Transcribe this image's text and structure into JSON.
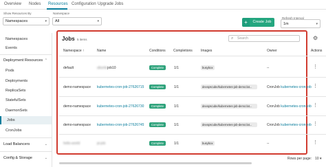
{
  "topnav": {
    "tabs": [
      "Overview",
      "Nodes",
      "Resources",
      "Configuration",
      "Upgrade Jobs"
    ],
    "active": "Resources"
  },
  "filters": {
    "show_resources_label": "Show Resources By",
    "show_resources_value": "Namespaces",
    "namespace_label": "Namespace",
    "namespace_value": "All",
    "refresh_label": "Refresh Interval",
    "refresh_value": "1m",
    "create_label": "Create Job",
    "plus_icon": "+"
  },
  "sidebar": {
    "items": [
      {
        "label": "Namespaces",
        "type": "item"
      },
      {
        "label": "Events",
        "type": "item"
      },
      {
        "label": "Deployment Resources",
        "type": "section"
      },
      {
        "label": "Pods",
        "type": "item"
      },
      {
        "label": "Deployments",
        "type": "item"
      },
      {
        "label": "ReplicaSets",
        "type": "item"
      },
      {
        "label": "StatefulSets",
        "type": "item"
      },
      {
        "label": "DaemonSets",
        "type": "item"
      },
      {
        "label": "Jobs",
        "type": "item",
        "active": true
      },
      {
        "label": "CronJobs",
        "type": "item"
      },
      {
        "label": "Load Balancers",
        "type": "section"
      },
      {
        "label": "Config & Storage",
        "type": "section"
      }
    ]
  },
  "jobs": {
    "title": "Jobs",
    "count": "5 items",
    "search_placeholder": "Search",
    "columns": [
      "Namespace",
      "Name",
      "Conditions",
      "Completions",
      "Images",
      "Owner",
      "Actions"
    ],
    "rows": [
      {
        "namespace": "default",
        "name": "job10",
        "name_prefix_blurred": "ubuntu",
        "condition": "Complete",
        "completions": "1/1",
        "image": "busybox",
        "owner": "--",
        "owner_kind": ""
      },
      {
        "namespace": "demo-namespace",
        "name": "kubernetes-cron-job-27626715",
        "condition": "Complete",
        "completions": "1/1",
        "image": "devopscube/kubernetes-job-demo:lat...",
        "owner_kind": "CronJob",
        "owner": "kubernetes-cron-job"
      },
      {
        "namespace": "demo-namespace",
        "name": "kubernetes-cron-job-27626730",
        "condition": "Complete",
        "completions": "1/1",
        "image": "devopscube/kubernetes-job-demo:lat...",
        "owner_kind": "CronJob",
        "owner": "kubernetes-cron-job"
      },
      {
        "namespace": "demo-namespace",
        "name": "kubernetes-cron-job-27626745",
        "condition": "Complete",
        "completions": "1/1",
        "image": "devopscube/kubernetes-job-demo:lat...",
        "owner_kind": "CronJob",
        "owner": "kubernetes-cron-job"
      },
      {
        "namespace": "hello-world",
        "namespace_blurred": true,
        "name": "pi-job",
        "name_blurred": true,
        "condition": "Complete",
        "completions": "1/1",
        "image": "busybox",
        "owner": "--",
        "owner_kind": ""
      }
    ],
    "sort_icon": "arrow-up-icon",
    "rows_per_page_label": "Rows per page:",
    "rows_per_page_value": "10"
  },
  "colors": {
    "accent": "#0a7d9c",
    "create_button": "#24a67f",
    "complete_badge": "#2fa37c",
    "highlight_border": "#d13b2f"
  }
}
